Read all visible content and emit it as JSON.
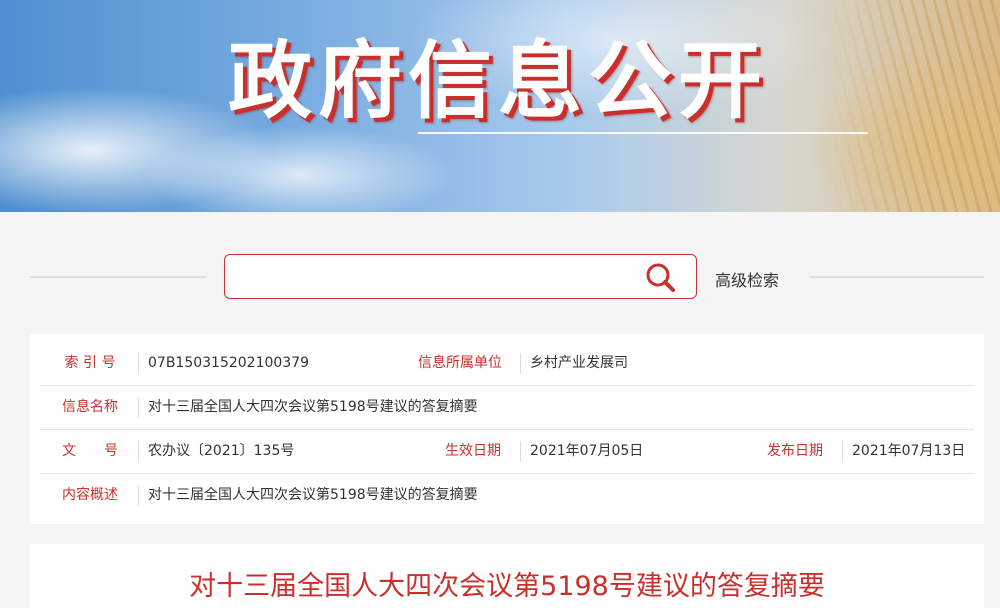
{
  "banner": {
    "title": "政府信息公开"
  },
  "search": {
    "value": "",
    "placeholder": "",
    "advanced_label": "高级检索"
  },
  "info": {
    "index_label": "索 引 号",
    "index_value": "07B150315202100379",
    "unit_label": "信息所属单位",
    "unit_value": "乡村产业发展司",
    "name_label": "信息名称",
    "name_value": "对十三届全国人大四次会议第5198号建议的答复摘要",
    "docno_label": "文　　号",
    "docno_value": "农办议〔2021〕135号",
    "effective_label": "生效日期",
    "effective_value": "2021年07月05日",
    "publish_label": "发布日期",
    "publish_value": "2021年07月13日",
    "summary_label": "内容概述",
    "summary_value": "对十三届全国人大四次会议第5198号建议的答复摘要"
  },
  "document": {
    "title": "对十三届全国人大四次会议第5198号建议的答复摘要"
  },
  "colors": {
    "accent": "#c9302c",
    "border": "#dddddd",
    "background": "#f5f5f5"
  },
  "icons": {
    "search": "search-icon"
  }
}
